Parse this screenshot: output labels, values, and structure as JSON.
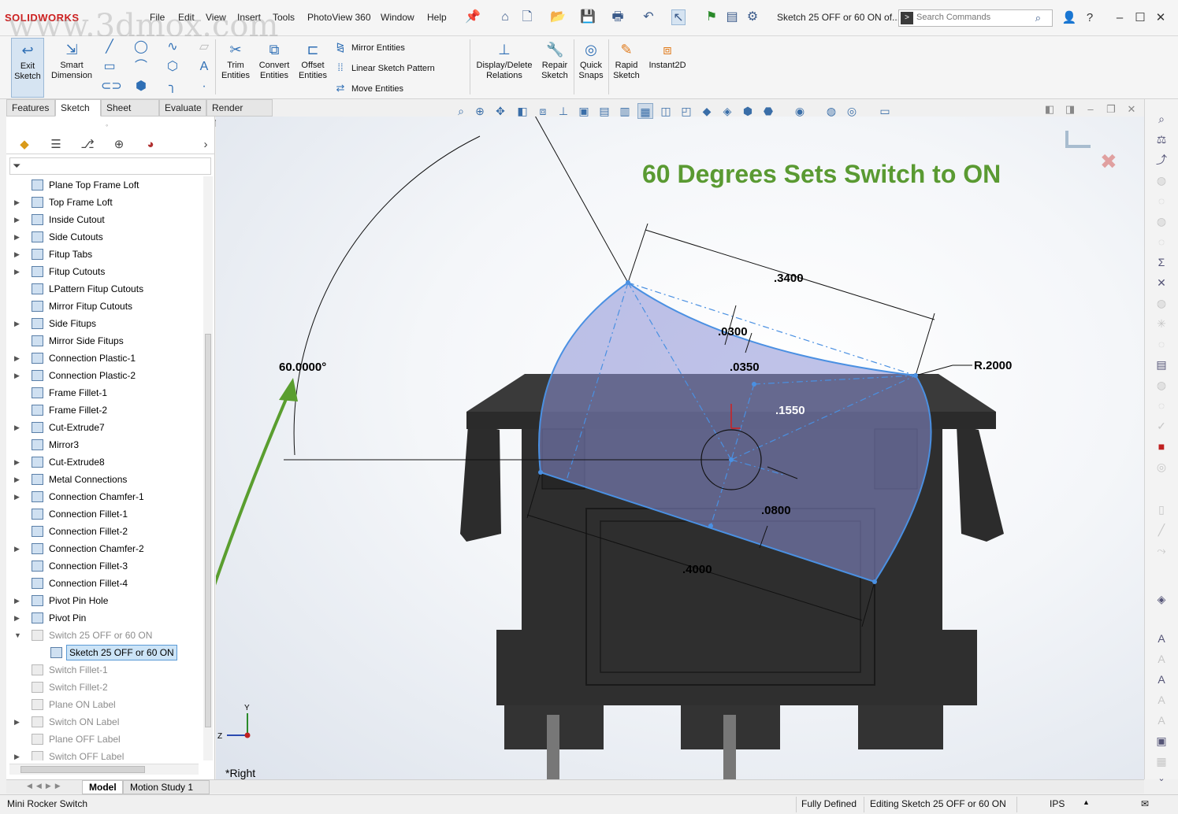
{
  "watermark": "www.3dmox.com",
  "app": {
    "logo": "SOLIDWORKS"
  },
  "menu": [
    "File",
    "Edit",
    "View",
    "Insert",
    "Tools",
    "PhotoView 360",
    "Window",
    "Help"
  ],
  "title": {
    "document": "Sketch 25 OFF or 60 ON of..."
  },
  "search": {
    "placeholder": "Search Commands"
  },
  "ribbon": {
    "exit_sketch": "Exit Sketch",
    "smart_dimension": "Smart Dimension",
    "trim_entities": "Trim Entities",
    "convert_entities": "Convert Entities",
    "offset_entities": "Offset Entities",
    "mirror_entities": "Mirror Entities",
    "linear_sketch_pattern": "Linear Sketch Pattern",
    "move_entities": "Move Entities",
    "display_delete_relations": "Display/Delete Relations",
    "repair_sketch": "Repair Sketch",
    "quick_snaps": "Quick Snaps",
    "rapid_sketch": "Rapid Sketch",
    "instant2d": "Instant2D"
  },
  "tabs": [
    "Features",
    "Sketch",
    "Sheet Metal",
    "Evaluate",
    "Render Tools"
  ],
  "tree": [
    {
      "label": "Plane Top Frame Loft",
      "expand": false
    },
    {
      "label": "Top Frame Loft",
      "expand": true
    },
    {
      "label": "Inside Cutout",
      "expand": true
    },
    {
      "label": "Side Cutouts",
      "expand": true
    },
    {
      "label": "Fitup Tabs",
      "expand": true
    },
    {
      "label": "Fitup Cutouts",
      "expand": true
    },
    {
      "label": "LPattern Fitup Cutouts",
      "expand": false
    },
    {
      "label": "Mirror Fitup Cutouts",
      "expand": false
    },
    {
      "label": "Side Fitups",
      "expand": true
    },
    {
      "label": "Mirror Side Fitups",
      "expand": false
    },
    {
      "label": "Connection Plastic-1",
      "expand": true
    },
    {
      "label": "Connection Plastic-2",
      "expand": true
    },
    {
      "label": "Frame Fillet-1",
      "expand": false
    },
    {
      "label": "Frame Fillet-2",
      "expand": false
    },
    {
      "label": "Cut-Extrude7",
      "expand": true
    },
    {
      "label": "Mirror3",
      "expand": false
    },
    {
      "label": "Cut-Extrude8",
      "expand": true
    },
    {
      "label": "Metal Connections",
      "expand": true
    },
    {
      "label": "Connection Chamfer-1",
      "expand": true
    },
    {
      "label": "Connection Fillet-1",
      "expand": false
    },
    {
      "label": "Connection Fillet-2",
      "expand": false
    },
    {
      "label": "Connection Chamfer-2",
      "expand": true
    },
    {
      "label": "Connection Fillet-3",
      "expand": false
    },
    {
      "label": "Connection Fillet-4",
      "expand": false
    },
    {
      "label": "Pivot Pin Hole",
      "expand": true
    },
    {
      "label": "Pivot Pin",
      "expand": true
    },
    {
      "label": "Switch 25 OFF or 60 ON",
      "expand": true,
      "dim": true,
      "open": true
    },
    {
      "label": "Sketch 25 OFF or 60 ON",
      "expand": false,
      "selected": true
    },
    {
      "label": "Switch Fillet-1",
      "expand": false,
      "dim": true
    },
    {
      "label": "Switch Fillet-2",
      "expand": false,
      "dim": true
    },
    {
      "label": "Plane ON Label",
      "expand": false,
      "dim": true
    },
    {
      "label": "Switch ON Label",
      "expand": true,
      "dim": true
    },
    {
      "label": "Plane OFF Label",
      "expand": false,
      "dim": true
    },
    {
      "label": "Switch OFF Label",
      "expand": true,
      "dim": true
    }
  ],
  "viewport": {
    "annotation": "60 Degrees Sets Switch to ON",
    "view_label": "*Right",
    "triad_y": "Y",
    "triad_z": "Z",
    "dimensions": {
      "angle": "60.0000°",
      "d1": ".3400",
      "d2": ".0300",
      "d3": ".0350",
      "d4": ".1550",
      "d5": ".0800",
      "d6": ".4000",
      "radius": "R.2000"
    }
  },
  "bottom_tabs": [
    "Model",
    "Motion Study 1"
  ],
  "status": {
    "doc": "Mini Rocker Switch",
    "state": "Fully Defined",
    "editing": "Editing Sketch 25 OFF or 60 ON",
    "units": "IPS"
  },
  "colors": {
    "annotation": "#5a9a32",
    "sketch": "#4a90e2",
    "fill": "#8a8fd6",
    "body": "#2f2f2f",
    "arrow": "#5a9e2f"
  }
}
